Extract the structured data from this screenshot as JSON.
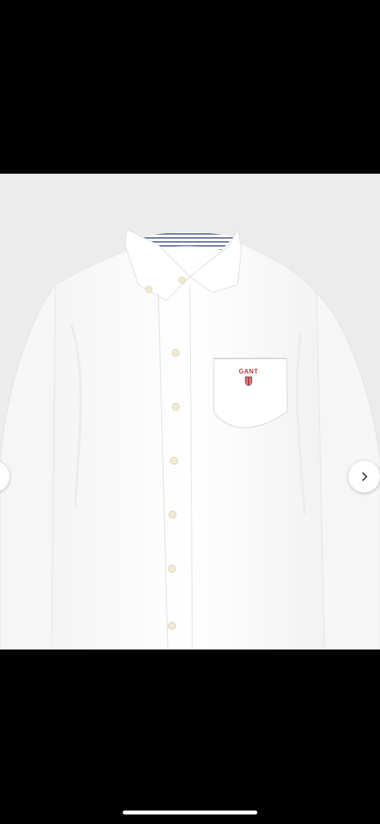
{
  "product": {
    "logo_text": "GANT",
    "image_name": "white-oxford-shirt"
  },
  "gallery": {
    "prev_icon": "chevron-left-icon",
    "next_icon": "chevron-right-icon"
  },
  "colors": {
    "background": "#000000",
    "viewer_bg": "#ececec",
    "shirt": "#ffffff",
    "collar_stripe": "#6d7a9b",
    "logo": "#c23a3a"
  }
}
